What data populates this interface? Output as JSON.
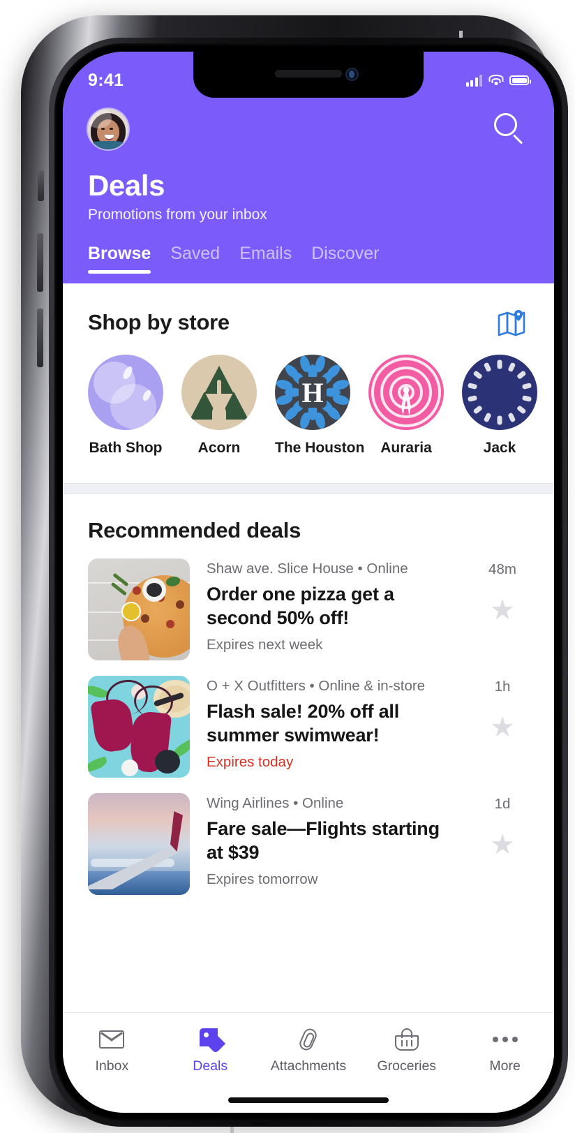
{
  "status_bar": {
    "time": "9:41",
    "signal_icon": "cellular-bars-icon",
    "wifi_icon": "wifi-icon",
    "battery_icon": "battery-full-icon"
  },
  "header": {
    "avatar_name": "user-avatar",
    "search_icon": "search-icon",
    "title": "Deals",
    "subtitle": "Promotions from your inbox",
    "accent_color": "#7B5CFA",
    "tabs": [
      {
        "label": "Browse",
        "active": true
      },
      {
        "label": "Saved",
        "active": false
      },
      {
        "label": "Emails",
        "active": false
      },
      {
        "label": "Discover",
        "active": false
      }
    ]
  },
  "shop_by_store": {
    "title": "Shop by store",
    "map_icon": "map-pin-icon",
    "map_icon_color": "#2E7BE0",
    "stores": [
      {
        "name": "Bath Shop",
        "logo": "bubbles-logo",
        "color": "#aaa0f2"
      },
      {
        "name": "Acorn",
        "logo": "pine-trees-logo",
        "color": "#dbc9ae"
      },
      {
        "name": "The Houston",
        "logo": "monogram-h-logo",
        "color": "#3f444d"
      },
      {
        "name": "Auraria",
        "logo": "radio-tower-logo",
        "color": "#F25CA2"
      },
      {
        "name": "Jack",
        "logo": "navy-circle-logo",
        "color": "#2b3275"
      }
    ]
  },
  "recommended": {
    "title": "Recommended deals",
    "deals": [
      {
        "store": "Shaw ave. Slice House • Online",
        "title": "Order one pizza get a second 50% off!",
        "expiry": "Expires next week",
        "expiry_urgent": false,
        "time": "48m",
        "thumb": "pizza-photo",
        "star_icon": "star-outline-icon"
      },
      {
        "store": "O + X Outfitters • Online & in-store",
        "title": "Flash sale! 20% off all summer swimwear!",
        "expiry": "Expires today",
        "expiry_urgent": true,
        "time": "1h",
        "thumb": "swimwear-photo",
        "star_icon": "star-outline-icon"
      },
      {
        "store": "Wing Airlines • Online",
        "title": "Fare sale—Flights starting at $39",
        "expiry": "Expires tomorrow",
        "expiry_urgent": false,
        "time": "1d",
        "thumb": "airplane-wing-photo",
        "star_icon": "star-outline-icon"
      }
    ]
  },
  "tab_bar": {
    "active_color": "#5b44ED",
    "items": [
      {
        "label": "Inbox",
        "icon": "envelope-icon",
        "active": false
      },
      {
        "label": "Deals",
        "icon": "tag-icon",
        "active": true
      },
      {
        "label": "Attachments",
        "icon": "paperclip-icon",
        "active": false
      },
      {
        "label": "Groceries",
        "icon": "basket-icon",
        "active": false
      },
      {
        "label": "More",
        "icon": "ellipsis-icon",
        "active": false
      }
    ]
  }
}
